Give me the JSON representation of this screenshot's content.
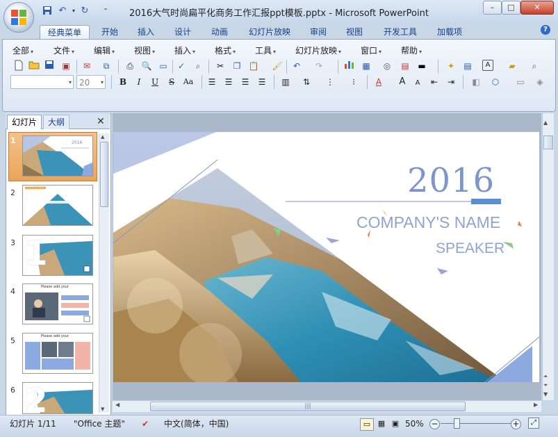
{
  "window": {
    "title": "2016大气时尚扁平化商务工作汇报ppt模板.pptx - Microsoft PowerPoint",
    "controls": [
      "–",
      "□",
      "✕"
    ]
  },
  "ribbon_tabs": [
    "经典菜单",
    "开始",
    "插入",
    "设计",
    "动画",
    "幻灯片放映",
    "审阅",
    "视图",
    "开发工具",
    "加载项"
  ],
  "classic_menu": [
    "全部",
    "文件",
    "编辑",
    "视图",
    "插入",
    "格式",
    "工具",
    "幻灯片放映",
    "窗口",
    "帮助"
  ],
  "format_toolbar": {
    "font_size": "20",
    "bold": "B",
    "italic": "I",
    "underline": "U",
    "strike": "S",
    "case": "Aa",
    "font_color": "A"
  },
  "panel": {
    "tab_slides": "幻灯片",
    "tab_outline": "大纲",
    "close": "✕",
    "slide_numbers": [
      "1",
      "2",
      "3",
      "4",
      "5",
      "6"
    ]
  },
  "thumbnails": {
    "t1_year": "2016",
    "t2_title": "CONTENT",
    "t3_num": "1",
    "t4_title": "Please add your",
    "t5_title": "Please add your",
    "t6_num": "2"
  },
  "slide": {
    "year": "2016",
    "company": "COMPANY'S NAME",
    "speaker": "SPEAKER"
  },
  "statusbar": {
    "slide_position": "幻灯片 1/11",
    "theme": "\"Office 主题\"",
    "language": "中文(简体，中国)",
    "zoom": "50%"
  },
  "colors": {
    "accent_blue": "#5b8fd3",
    "slide_text": "#7d95c9",
    "sea": "#2f8fb4"
  }
}
